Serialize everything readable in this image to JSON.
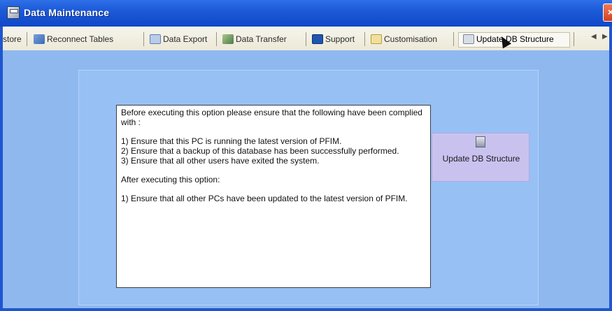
{
  "window": {
    "title": "Data Maintenance",
    "close_label": "×"
  },
  "toolbar": {
    "items": [
      {
        "label": "store",
        "icon": "restore-icon"
      },
      {
        "label": "Reconnect Tables",
        "icon": "reconnect-tables-icon"
      },
      {
        "label": "Data Export",
        "icon": "data-export-icon"
      },
      {
        "label": "Data Transfer",
        "icon": "data-transfer-icon"
      },
      {
        "label": "Support",
        "icon": "support-icon"
      },
      {
        "label": "Customisation",
        "icon": "customisation-icon"
      },
      {
        "label": "Update DB Structure",
        "icon": "update-db-structure-icon",
        "active": true
      }
    ],
    "scroll_left": "◀",
    "scroll_right": "▶"
  },
  "notice": {
    "lines": [
      "Before executing this option please ensure that the following have been complied with :",
      "1) Ensure that this PC is running the latest version of PFIM.",
      "2) Ensure that a backup of this database has been successfully performed.",
      "3) Ensure that all other users have exited the system.",
      "After executing this option:",
      "1) Ensure that all other PCs have been updated to the latest version of PFIM."
    ]
  },
  "action": {
    "label": "Update DB Structure",
    "icon": "database-update-icon"
  },
  "colors": {
    "titlebar": "#1c5ad8",
    "content_bg": "#8fb8ef",
    "panel_bg": "#97c0f4",
    "action_tile": "#c9c2ef"
  }
}
